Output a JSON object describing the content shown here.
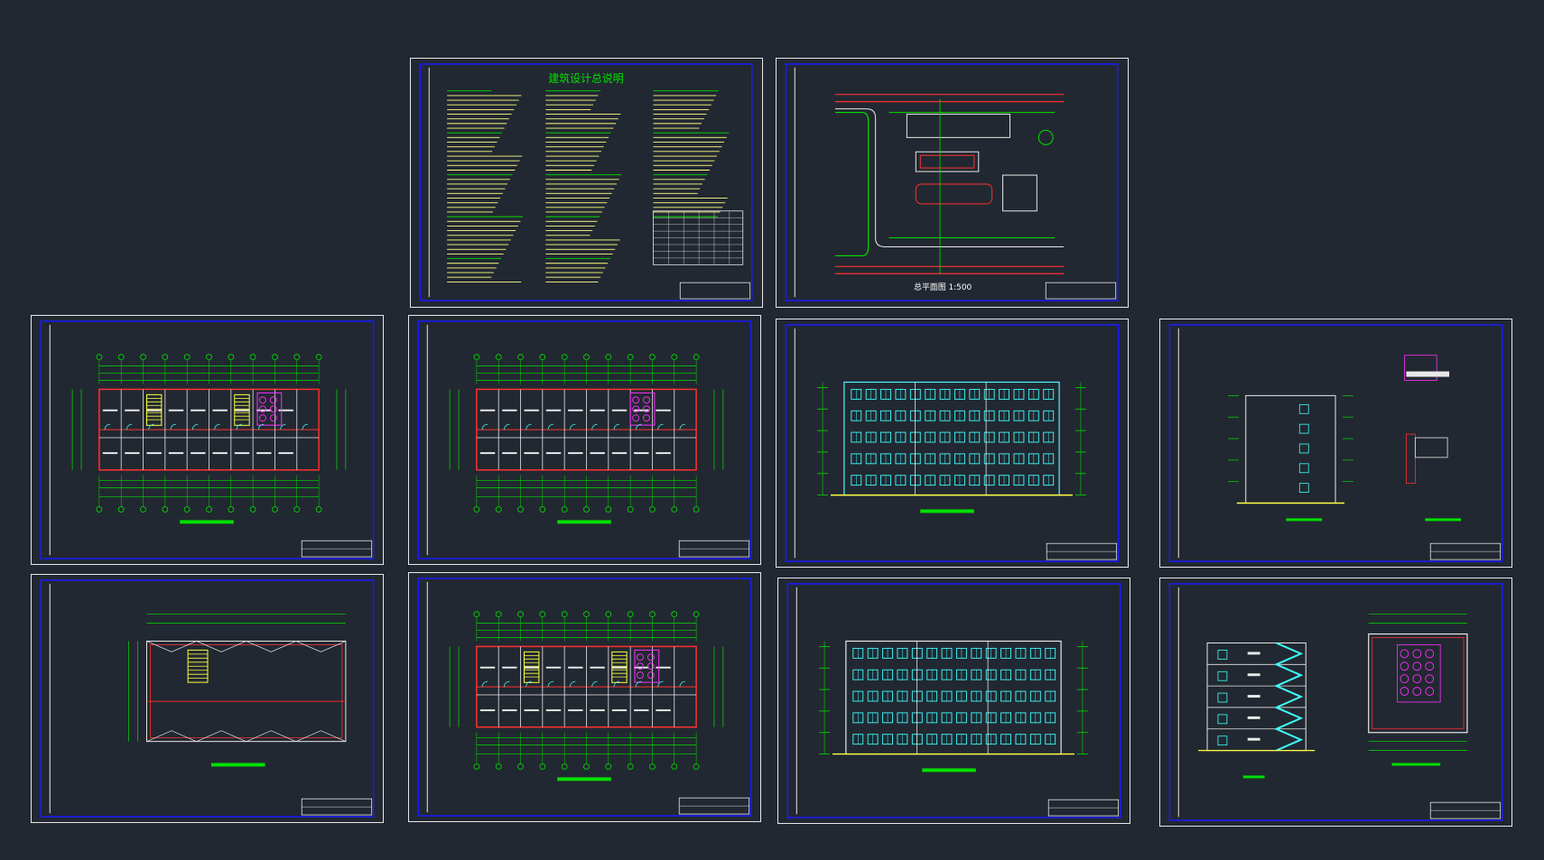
{
  "drawing_set": {
    "background_color": "#222831",
    "sheets": [
      {
        "id": "general-notes",
        "kind": "notes",
        "title": "建筑设计总说明"
      },
      {
        "id": "site-plan",
        "kind": "site",
        "scale_label": "总平面图 1:500"
      },
      {
        "id": "floor-plan-a",
        "kind": "plan"
      },
      {
        "id": "ground-floor-plan",
        "kind": "plan"
      },
      {
        "id": "front-elevation",
        "kind": "elevation"
      },
      {
        "id": "side-elevation-details",
        "kind": "side"
      },
      {
        "id": "roof-plan",
        "kind": "roof"
      },
      {
        "id": "typical-floor-plan",
        "kind": "plan"
      },
      {
        "id": "rear-elevation",
        "kind": "elevation"
      },
      {
        "id": "section-stair",
        "kind": "section"
      }
    ]
  },
  "colors": {
    "frame": "#e8e8e8",
    "inner_frame": "#1a1aff",
    "dim_green": "#00e000",
    "wall_red": "#ff3030",
    "stair_yellow": "#ffff40",
    "toilet_magenta": "#ff30ff",
    "window_cyan": "#40ffff",
    "text_white": "#ffffff"
  }
}
